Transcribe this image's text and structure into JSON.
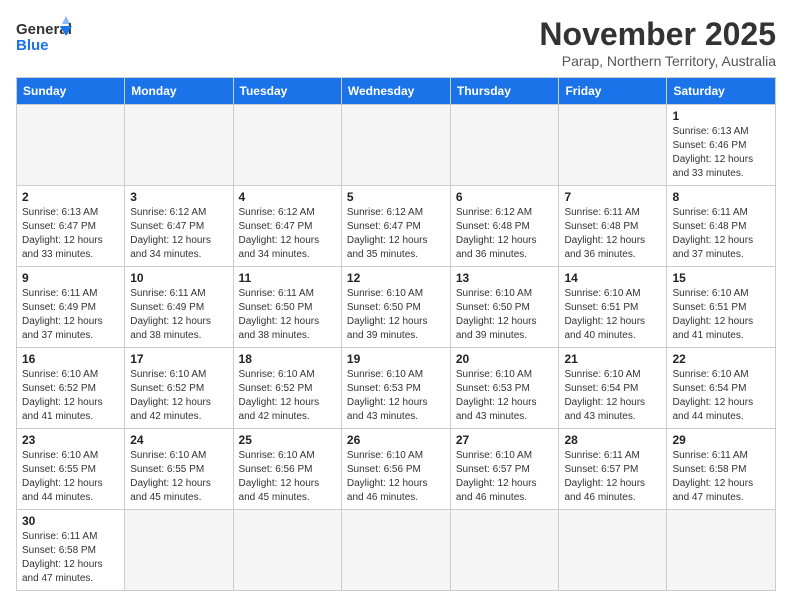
{
  "header": {
    "logo_general": "General",
    "logo_blue": "Blue",
    "month_title": "November 2025",
    "subtitle": "Parap, Northern Territory, Australia"
  },
  "days_of_week": [
    "Sunday",
    "Monday",
    "Tuesday",
    "Wednesday",
    "Thursday",
    "Friday",
    "Saturday"
  ],
  "weeks": [
    [
      {
        "day": "",
        "info": ""
      },
      {
        "day": "",
        "info": ""
      },
      {
        "day": "",
        "info": ""
      },
      {
        "day": "",
        "info": ""
      },
      {
        "day": "",
        "info": ""
      },
      {
        "day": "",
        "info": ""
      },
      {
        "day": "1",
        "info": "Sunrise: 6:13 AM\nSunset: 6:46 PM\nDaylight: 12 hours and 33 minutes."
      }
    ],
    [
      {
        "day": "2",
        "info": "Sunrise: 6:13 AM\nSunset: 6:47 PM\nDaylight: 12 hours and 33 minutes."
      },
      {
        "day": "3",
        "info": "Sunrise: 6:12 AM\nSunset: 6:47 PM\nDaylight: 12 hours and 34 minutes."
      },
      {
        "day": "4",
        "info": "Sunrise: 6:12 AM\nSunset: 6:47 PM\nDaylight: 12 hours and 34 minutes."
      },
      {
        "day": "5",
        "info": "Sunrise: 6:12 AM\nSunset: 6:47 PM\nDaylight: 12 hours and 35 minutes."
      },
      {
        "day": "6",
        "info": "Sunrise: 6:12 AM\nSunset: 6:48 PM\nDaylight: 12 hours and 36 minutes."
      },
      {
        "day": "7",
        "info": "Sunrise: 6:11 AM\nSunset: 6:48 PM\nDaylight: 12 hours and 36 minutes."
      },
      {
        "day": "8",
        "info": "Sunrise: 6:11 AM\nSunset: 6:48 PM\nDaylight: 12 hours and 37 minutes."
      }
    ],
    [
      {
        "day": "9",
        "info": "Sunrise: 6:11 AM\nSunset: 6:49 PM\nDaylight: 12 hours and 37 minutes."
      },
      {
        "day": "10",
        "info": "Sunrise: 6:11 AM\nSunset: 6:49 PM\nDaylight: 12 hours and 38 minutes."
      },
      {
        "day": "11",
        "info": "Sunrise: 6:11 AM\nSunset: 6:50 PM\nDaylight: 12 hours and 38 minutes."
      },
      {
        "day": "12",
        "info": "Sunrise: 6:10 AM\nSunset: 6:50 PM\nDaylight: 12 hours and 39 minutes."
      },
      {
        "day": "13",
        "info": "Sunrise: 6:10 AM\nSunset: 6:50 PM\nDaylight: 12 hours and 39 minutes."
      },
      {
        "day": "14",
        "info": "Sunrise: 6:10 AM\nSunset: 6:51 PM\nDaylight: 12 hours and 40 minutes."
      },
      {
        "day": "15",
        "info": "Sunrise: 6:10 AM\nSunset: 6:51 PM\nDaylight: 12 hours and 41 minutes."
      }
    ],
    [
      {
        "day": "16",
        "info": "Sunrise: 6:10 AM\nSunset: 6:52 PM\nDaylight: 12 hours and 41 minutes."
      },
      {
        "day": "17",
        "info": "Sunrise: 6:10 AM\nSunset: 6:52 PM\nDaylight: 12 hours and 42 minutes."
      },
      {
        "day": "18",
        "info": "Sunrise: 6:10 AM\nSunset: 6:52 PM\nDaylight: 12 hours and 42 minutes."
      },
      {
        "day": "19",
        "info": "Sunrise: 6:10 AM\nSunset: 6:53 PM\nDaylight: 12 hours and 43 minutes."
      },
      {
        "day": "20",
        "info": "Sunrise: 6:10 AM\nSunset: 6:53 PM\nDaylight: 12 hours and 43 minutes."
      },
      {
        "day": "21",
        "info": "Sunrise: 6:10 AM\nSunset: 6:54 PM\nDaylight: 12 hours and 43 minutes."
      },
      {
        "day": "22",
        "info": "Sunrise: 6:10 AM\nSunset: 6:54 PM\nDaylight: 12 hours and 44 minutes."
      }
    ],
    [
      {
        "day": "23",
        "info": "Sunrise: 6:10 AM\nSunset: 6:55 PM\nDaylight: 12 hours and 44 minutes."
      },
      {
        "day": "24",
        "info": "Sunrise: 6:10 AM\nSunset: 6:55 PM\nDaylight: 12 hours and 45 minutes."
      },
      {
        "day": "25",
        "info": "Sunrise: 6:10 AM\nSunset: 6:56 PM\nDaylight: 12 hours and 45 minutes."
      },
      {
        "day": "26",
        "info": "Sunrise: 6:10 AM\nSunset: 6:56 PM\nDaylight: 12 hours and 46 minutes."
      },
      {
        "day": "27",
        "info": "Sunrise: 6:10 AM\nSunset: 6:57 PM\nDaylight: 12 hours and 46 minutes."
      },
      {
        "day": "28",
        "info": "Sunrise: 6:11 AM\nSunset: 6:57 PM\nDaylight: 12 hours and 46 minutes."
      },
      {
        "day": "29",
        "info": "Sunrise: 6:11 AM\nSunset: 6:58 PM\nDaylight: 12 hours and 47 minutes."
      }
    ],
    [
      {
        "day": "30",
        "info": "Sunrise: 6:11 AM\nSunset: 6:58 PM\nDaylight: 12 hours and 47 minutes."
      },
      {
        "day": "",
        "info": ""
      },
      {
        "day": "",
        "info": ""
      },
      {
        "day": "",
        "info": ""
      },
      {
        "day": "",
        "info": ""
      },
      {
        "day": "",
        "info": ""
      },
      {
        "day": "",
        "info": ""
      }
    ]
  ]
}
